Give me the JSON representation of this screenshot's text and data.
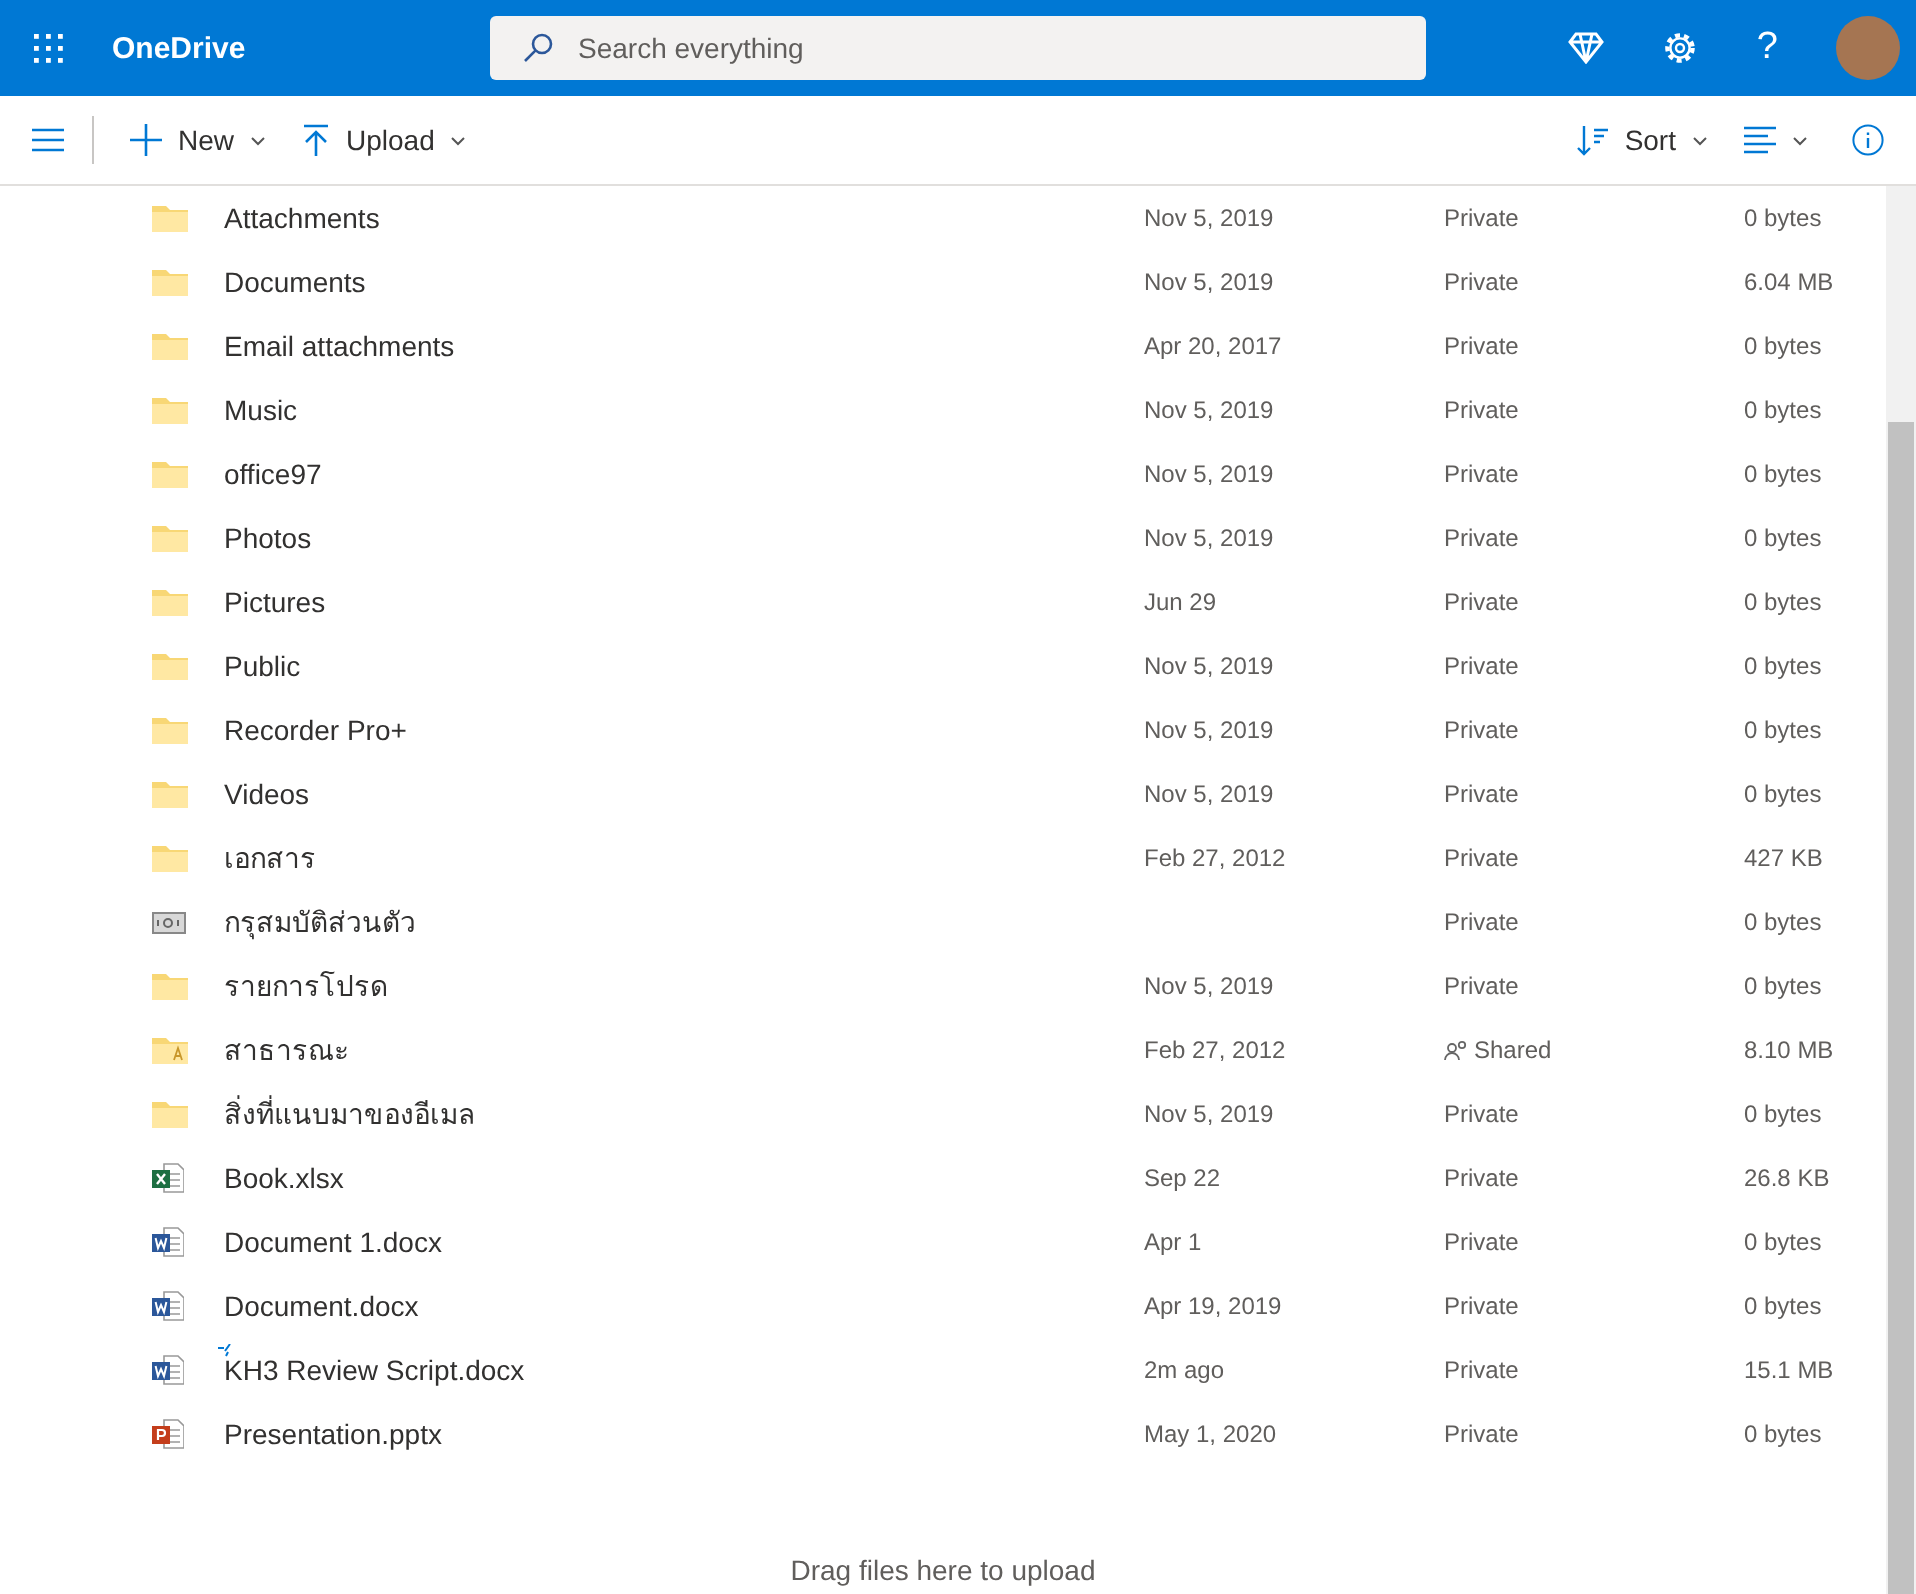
{
  "header": {
    "app_name": "OneDrive",
    "search": {
      "placeholder": "Search everything"
    },
    "help": "?"
  },
  "toolbar": {
    "new": "New",
    "upload": "Upload",
    "sort": "Sort"
  },
  "files": [
    {
      "kind": "folder",
      "name": "Attachments",
      "modified": "Nov 5, 2019",
      "sharing": "Private",
      "shared": false,
      "size": "0 bytes",
      "recent": false
    },
    {
      "kind": "folder",
      "name": "Documents",
      "modified": "Nov 5, 2019",
      "sharing": "Private",
      "shared": false,
      "size": "6.04 MB",
      "recent": false
    },
    {
      "kind": "folder",
      "name": "Email attachments",
      "modified": "Apr 20, 2017",
      "sharing": "Private",
      "shared": false,
      "size": "0 bytes",
      "recent": false
    },
    {
      "kind": "folder",
      "name": "Music",
      "modified": "Nov 5, 2019",
      "sharing": "Private",
      "shared": false,
      "size": "0 bytes",
      "recent": false
    },
    {
      "kind": "folder",
      "name": "office97",
      "modified": "Nov 5, 2019",
      "sharing": "Private",
      "shared": false,
      "size": "0 bytes",
      "recent": false
    },
    {
      "kind": "folder",
      "name": "Photos",
      "modified": "Nov 5, 2019",
      "sharing": "Private",
      "shared": false,
      "size": "0 bytes",
      "recent": false
    },
    {
      "kind": "folder",
      "name": "Pictures",
      "modified": "Jun 29",
      "sharing": "Private",
      "shared": false,
      "size": "0 bytes",
      "recent": false
    },
    {
      "kind": "folder",
      "name": "Public",
      "modified": "Nov 5, 2019",
      "sharing": "Private",
      "shared": false,
      "size": "0 bytes",
      "recent": false
    },
    {
      "kind": "folder",
      "name": "Recorder Pro+",
      "modified": "Nov 5, 2019",
      "sharing": "Private",
      "shared": false,
      "size": "0 bytes",
      "recent": false
    },
    {
      "kind": "folder",
      "name": "Videos",
      "modified": "Nov 5, 2019",
      "sharing": "Private",
      "shared": false,
      "size": "0 bytes",
      "recent": false
    },
    {
      "kind": "folder",
      "name": "เอกสาร",
      "modified": "Feb 27, 2012",
      "sharing": "Private",
      "shared": false,
      "size": "427 KB",
      "recent": false
    },
    {
      "kind": "vault",
      "name": "กรุสมบัติส่วนตัว",
      "sharing": "Private",
      "shared": false,
      "size": "0 bytes",
      "recent": false
    },
    {
      "kind": "folder",
      "name": "รายการโปรด",
      "modified": "Nov 5, 2019",
      "sharing": "Private",
      "shared": false,
      "size": "0 bytes",
      "recent": false
    },
    {
      "kind": "shared-folder",
      "name": "สาธารณะ",
      "modified": "Feb 27, 2012",
      "sharing": "Shared",
      "shared": true,
      "size": "8.10 MB",
      "recent": false
    },
    {
      "kind": "folder",
      "name": "สิ่งที่แนบมาของอีเมล",
      "modified": "Nov 5, 2019",
      "sharing": "Private",
      "shared": false,
      "size": "0 bytes",
      "recent": false
    },
    {
      "kind": "excel",
      "name": "Book.xlsx",
      "modified": "Sep 22",
      "sharing": "Private",
      "shared": false,
      "size": "26.8 KB",
      "recent": false
    },
    {
      "kind": "word",
      "name": "Document 1.docx",
      "modified": "Apr 1",
      "sharing": "Private",
      "shared": false,
      "size": "0 bytes",
      "recent": false
    },
    {
      "kind": "word",
      "name": "Document.docx",
      "modified": "Apr 19, 2019",
      "sharing": "Private",
      "shared": false,
      "size": "0 bytes",
      "recent": false
    },
    {
      "kind": "word",
      "name": "KH3 Review Script.docx",
      "modified": "2m ago",
      "sharing": "Private",
      "shared": false,
      "size": "15.1 MB",
      "recent": true
    },
    {
      "kind": "powerpoint",
      "name": "Presentation.pptx",
      "modified": "May 1, 2020",
      "sharing": "Private",
      "shared": false,
      "size": "0 bytes",
      "recent": false
    }
  ],
  "drop_hint": "Drag files here to upload"
}
